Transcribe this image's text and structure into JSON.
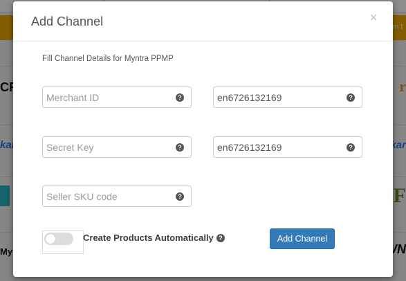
{
  "background": {
    "banner_left_text": "",
    "banner_right_text": "om t",
    "logos_left": [
      "CR",
      "kar",
      "",
      "My"
    ],
    "logos_right": [
      "r",
      "kar",
      "EF",
      "WN"
    ]
  },
  "modal": {
    "title": "Add Channel",
    "close_label": "×",
    "subtitle": "Fill Channel Details for Myntra PPMP",
    "fields": {
      "merchant_id": {
        "placeholder": "Merchant ID",
        "value": ""
      },
      "merchant_value": {
        "placeholder": "",
        "value": "en6726132169"
      },
      "secret_key": {
        "placeholder": "Secret Key",
        "value": ""
      },
      "secret_value": {
        "placeholder": "",
        "value": "en6726132169"
      },
      "seller_sku": {
        "placeholder": "Seller SKU code",
        "value": ""
      }
    },
    "help_glyph": "?",
    "toggle": {
      "label": "Create Products Automatically",
      "on": false
    },
    "submit_label": "Add Channel"
  },
  "colors": {
    "accent": "#337ab7",
    "banner": "#f2a900",
    "overlay": "rgba(0,0,0,0.45)"
  }
}
